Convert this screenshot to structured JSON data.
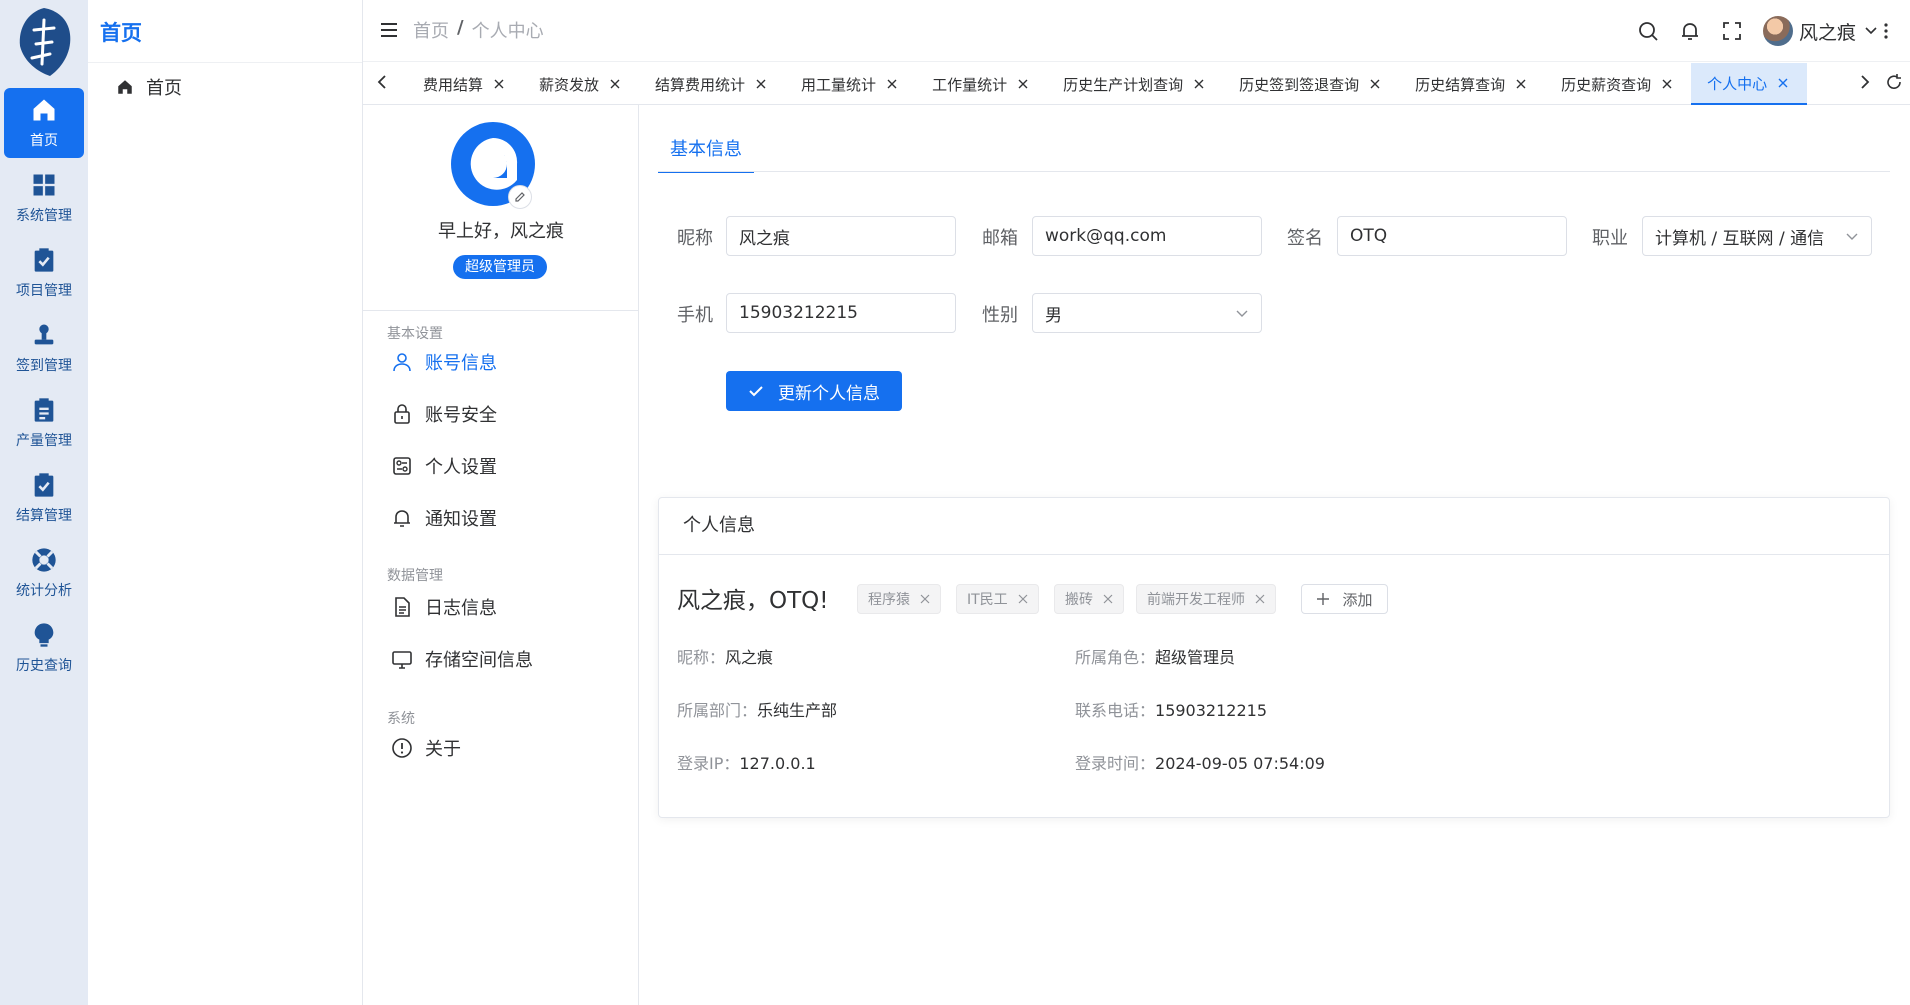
{
  "rail": {
    "items": [
      {
        "label": "首页",
        "icon": "home-icon"
      },
      {
        "label": "系统管理",
        "icon": "grid-icon"
      },
      {
        "label": "项目管理",
        "icon": "clipboard-check-icon"
      },
      {
        "label": "签到管理",
        "icon": "stamp-icon"
      },
      {
        "label": "产量管理",
        "icon": "clipboard-list-icon"
      },
      {
        "label": "结算管理",
        "icon": "clipboard-check-icon"
      },
      {
        "label": "统计分析",
        "icon": "lifebuoy-icon"
      },
      {
        "label": "历史查询",
        "icon": "lightbulb-icon"
      }
    ]
  },
  "submenu": {
    "title": "首页",
    "items": [
      {
        "label": "首页",
        "icon": "home-icon"
      }
    ]
  },
  "header": {
    "breadcrumb": [
      "首页",
      "个人中心"
    ],
    "user_name": "风之痕"
  },
  "tabs": [
    "费用结算",
    "薪资发放",
    "结算费用统计",
    "用工量统计",
    "工作量统计",
    "历史生产计划查询",
    "历史签到签退查询",
    "历史结算查询",
    "历史薪资查询",
    "个人中心"
  ],
  "profile": {
    "greeting": "早上好，风之痕",
    "role": "超级管理员",
    "groups": [
      "基本设置",
      "数据管理",
      "系统"
    ],
    "menu": {
      "account_info": "账号信息",
      "account_security": "账号安全",
      "personal_settings": "个人设置",
      "notification_settings": "通知设置",
      "log_info": "日志信息",
      "storage_info": "存储空间信息",
      "about": "关于"
    }
  },
  "form": {
    "section_tab": "基本信息",
    "nickname_label": "昵称",
    "nickname": "风之痕",
    "email_label": "邮箱",
    "email": "work@qq.com",
    "sign_label": "签名",
    "sign": "OTQ",
    "job_label": "职业",
    "job": "计算机 / 互联网 / 通信",
    "phone_label": "手机",
    "phone": "15903212215",
    "gender_label": "性别",
    "gender": "男",
    "update_button": "更新个人信息"
  },
  "card": {
    "title": "个人信息",
    "name": "风之痕，OTQ!",
    "tags": [
      "程序猿",
      "IT民工",
      "搬砖",
      "前端开发工程师"
    ],
    "add_label": "添加",
    "info": {
      "nickname_k": "昵称：",
      "nickname_v": "风之痕",
      "role_k": "所属角色：",
      "role_v": "超级管理员",
      "dept_k": "所属部门：",
      "dept_v": "乐纯生产部",
      "phone_k": "联系电话：",
      "phone_v": "15903212215",
      "ip_k": "登录IP：",
      "ip_v": "127.0.0.1",
      "time_k": "登录时间：",
      "time_v": "2024-09-05 07:54:09"
    }
  },
  "colors": {
    "primary": "#1570ef",
    "rail_bg": "#e4eaf4",
    "rail_text": "#1f5496"
  }
}
